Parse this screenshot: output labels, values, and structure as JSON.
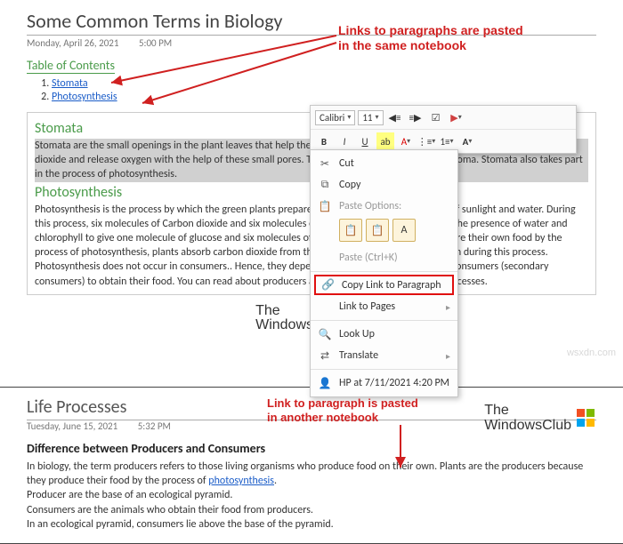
{
  "page1": {
    "title": "Some Common Terms in Biology",
    "date": "Monday, April 26, 2021",
    "time": "5:00 PM",
    "toc_title": "Table of Contents",
    "toc": [
      {
        "label": "Stomata"
      },
      {
        "label": "Photosynthesis"
      }
    ],
    "annotation": "Links to paragraphs are pasted\nin the same notebook",
    "sections": {
      "stomata": {
        "heading": "Stomata",
        "text": "Stomata are the small openings in the plant leaves that help the plants in the exchange of gases. The plants take in carbon dioxide and release oxygen with the help of these small pores. The singular word for Stomata is Stoma. Stomata also takes part in the process of photosynthesis."
      },
      "photo": {
        "heading": "Photosynthesis",
        "text_a": "Photosynthesis is the process by which the green plants prepare their own food in the presence of sunlight and water. During this process, six molecules of Carbon dioxide and six molecules of water react with each other in the presence of water and chlorophyll to give one molecule of glucose and six molecules of oxygen. Since green plants prepare their own food by the process of photosynthesis, plants absorb carbon dioxide from the environment and release oxygen during this process.",
        "text_b": "Photosynthesis does not occur in consumers.. Hence, they depend on eating other producers or consumers (secondary consumers) to obtain their food. You can read about producers and consumers in detail in Life Processes."
      }
    }
  },
  "toolbar": {
    "font": "Calibri",
    "size": "11"
  },
  "menu": {
    "cut": "Cut",
    "copy": "Copy",
    "paste_options": "Paste Options:",
    "paste": "Paste (Ctrl+K)",
    "copy_link": "Copy Link to Paragraph",
    "link_pages": "Link to Pages",
    "lookup": "Look Up",
    "translate": "Translate",
    "hp": "HP at 7/11/2021 4:20 PM"
  },
  "logo": {
    "line1": "The",
    "line2": "WindowsClub"
  },
  "watermark": "wsxdn.com",
  "page2": {
    "title": "Life Processes",
    "date": "Tuesday, June 15, 2021",
    "time": "5:32 PM",
    "annotation": "Link to paragraph is pasted\nin another notebook",
    "subheading": "Difference between Producers and Consumers",
    "body_a": "In biology, the term producers refers to those living organisms who produce food on their own. Plants are the producers because they produce their food by the process of ",
    "link": "photosynthesis",
    "body_b": ".",
    "lines": [
      "Producer are the base of an ecological pyramid.",
      "Consumers are the animals who obtain their food from producers.",
      "In an ecological pyramid, consumers lie above the base of the pyramid."
    ]
  }
}
